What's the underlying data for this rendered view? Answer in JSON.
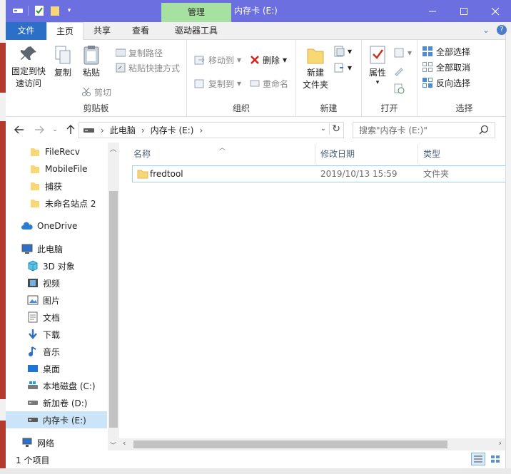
{
  "window": {
    "title": "内存卡 (E:)",
    "context_tab": "管理",
    "minimize": "—",
    "maximize": "☐",
    "close": "✕"
  },
  "tabs": {
    "file": "文件",
    "home": "主页",
    "share": "共享",
    "view": "查看",
    "drive_tools": "驱动器工具"
  },
  "ribbon": {
    "clipboard": {
      "label": "剪贴板",
      "pin": "固定到快速访问",
      "pin_line1": "固定到快",
      "pin_line2": "速访问",
      "copy": "复制",
      "paste": "粘贴",
      "copy_path": "复制路径",
      "paste_shortcut": "粘贴快捷方式",
      "cut": "剪切"
    },
    "organize": {
      "label": "组织",
      "move_to": "移动到",
      "copy_to": "复制到",
      "delete": "删除",
      "rename": "重命名"
    },
    "new": {
      "label": "新建",
      "new_folder_line1": "新建",
      "new_folder_line2": "文件夹"
    },
    "open": {
      "label": "打开",
      "properties": "属性"
    },
    "select": {
      "label": "选择",
      "select_all": "全部选择",
      "select_none": "全部取消",
      "invert": "反向选择"
    }
  },
  "address": {
    "segments": [
      "此电脑",
      "内存卡 (E:)"
    ],
    "search_placeholder": "搜索\"内存卡 (E:)\""
  },
  "nav": {
    "quick_items": [
      "FileRecv",
      "MobileFile",
      "捕获",
      "未命名站点 2"
    ],
    "onedrive": "OneDrive",
    "this_pc": "此电脑",
    "pc_items": [
      "3D 对象",
      "视频",
      "图片",
      "文档",
      "下载",
      "音乐",
      "桌面",
      "本地磁盘 (C:)",
      "新加卷 (D:)",
      "内存卡 (E:)"
    ],
    "network": "网络"
  },
  "content": {
    "columns": {
      "name": "名称",
      "date": "修改日期",
      "type": "类型"
    },
    "rows": [
      {
        "name": "fredtool",
        "date": "2019/10/13 15:59",
        "type": "文件夹"
      }
    ]
  },
  "status": {
    "item_count": "1 个项目"
  },
  "colors": {
    "titlebar": "#6b6fe0",
    "context_tab": "#a7e1a2",
    "file_tab": "#2b6fc7",
    "folder": "#f8d775",
    "selection": "#cce4f7"
  }
}
